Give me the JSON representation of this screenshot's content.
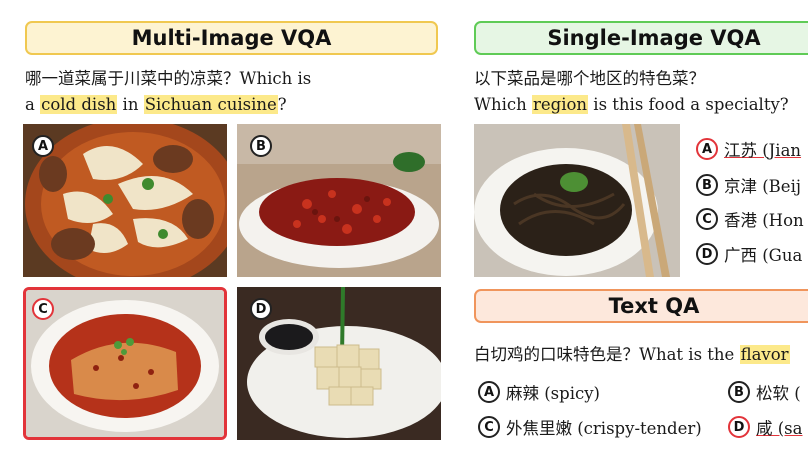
{
  "multi": {
    "title": "Multi-Image VQA",
    "question_zh": "哪一道菜属于川菜中的凉菜？Which is",
    "q2_pre": "a ",
    "q2_hl1": "cold dish",
    "q2_mid": " in ",
    "q2_hl2": "Sichuan cuisine",
    "q2_post": "?",
    "images": [
      {
        "label": "A",
        "content": "noodle-soup-photo"
      },
      {
        "label": "B",
        "content": "dried-chili-dish-photo"
      },
      {
        "label": "C",
        "content": "sliced-chicken-chili-oil-photo",
        "selected": true
      },
      {
        "label": "D",
        "content": "white-cut-chicken-photo"
      }
    ]
  },
  "single": {
    "title": "Single-Image VQA",
    "question_zh": "以下菜品是哪个地区的特色菜？",
    "q2_pre": "Which ",
    "q2_hl": "region",
    "q2_post": " is this food a specialty?",
    "options": [
      {
        "label": "A",
        "text": "江苏 (Jian",
        "selected": true
      },
      {
        "label": "B",
        "text": "京津 (Beij"
      },
      {
        "label": "C",
        "text": "香港 (Hon"
      },
      {
        "label": "D",
        "text": "广西 (Gua"
      }
    ]
  },
  "textqa": {
    "title": "Text QA",
    "question_pre": "白切鸡的口味特色是？What is the ",
    "question_hl": "flavor",
    "options": [
      {
        "label": "A",
        "text": "麻辣 (spicy)"
      },
      {
        "label": "B",
        "text": "松软 ("
      },
      {
        "label": "C",
        "text": "外焦里嫩 (crispy-tender)"
      },
      {
        "label": "D",
        "text": "咸 (sa",
        "selected": true
      }
    ]
  },
  "colors": {
    "highlight": "#fce98a",
    "correct": "#e2343a"
  }
}
